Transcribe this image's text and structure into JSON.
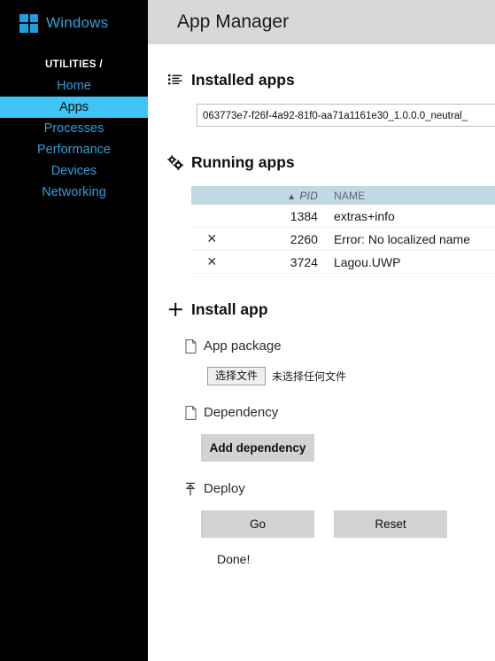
{
  "sidebar": {
    "brand": "Windows",
    "brand_logo_icon": "windows-logo-icon",
    "section_label": "UTILITIES /",
    "items": [
      {
        "label": "Home",
        "active": false
      },
      {
        "label": "Apps",
        "active": true
      },
      {
        "label": "Processes",
        "active": false
      },
      {
        "label": "Performance",
        "active": false
      },
      {
        "label": "Devices",
        "active": false
      },
      {
        "label": "Networking",
        "active": false
      }
    ],
    "active_color": "#40c4f5",
    "link_color": "#2f9fd8",
    "background": "#000000"
  },
  "header": {
    "title": "App Manager",
    "background": "#d8d8d8"
  },
  "installed_apps": {
    "icon": "list-icon",
    "title": "Installed apps",
    "selected_value": "063773e7-f26f-4a92-81f0-aa71a1161e30_1.0.0.0_neutral_"
  },
  "running_apps": {
    "icon": "gears-icon",
    "title": "Running apps",
    "columns": {
      "close": "",
      "pid": "PID",
      "name": "NAME"
    },
    "sort_glyph": "▲",
    "close_glyph": "✕",
    "rows": [
      {
        "closable": false,
        "pid": "1384",
        "name": "extras+info"
      },
      {
        "closable": true,
        "pid": "2260",
        "name": "Error: No localized name"
      },
      {
        "closable": true,
        "pid": "3724",
        "name": "Lagou.UWP"
      }
    ]
  },
  "install_app": {
    "icon": "plus-icon",
    "title": "Install app",
    "app_package": {
      "icon": "file-icon",
      "label": "App package",
      "choose_button": "选择文件",
      "file_status": "未选择任何文件"
    },
    "dependency": {
      "icon": "file-icon",
      "label": "Dependency",
      "add_button": "Add dependency"
    },
    "deploy": {
      "icon": "upload-arrow-icon",
      "label": "Deploy",
      "go_button": "Go",
      "reset_button": "Reset",
      "status": "Done!"
    }
  }
}
